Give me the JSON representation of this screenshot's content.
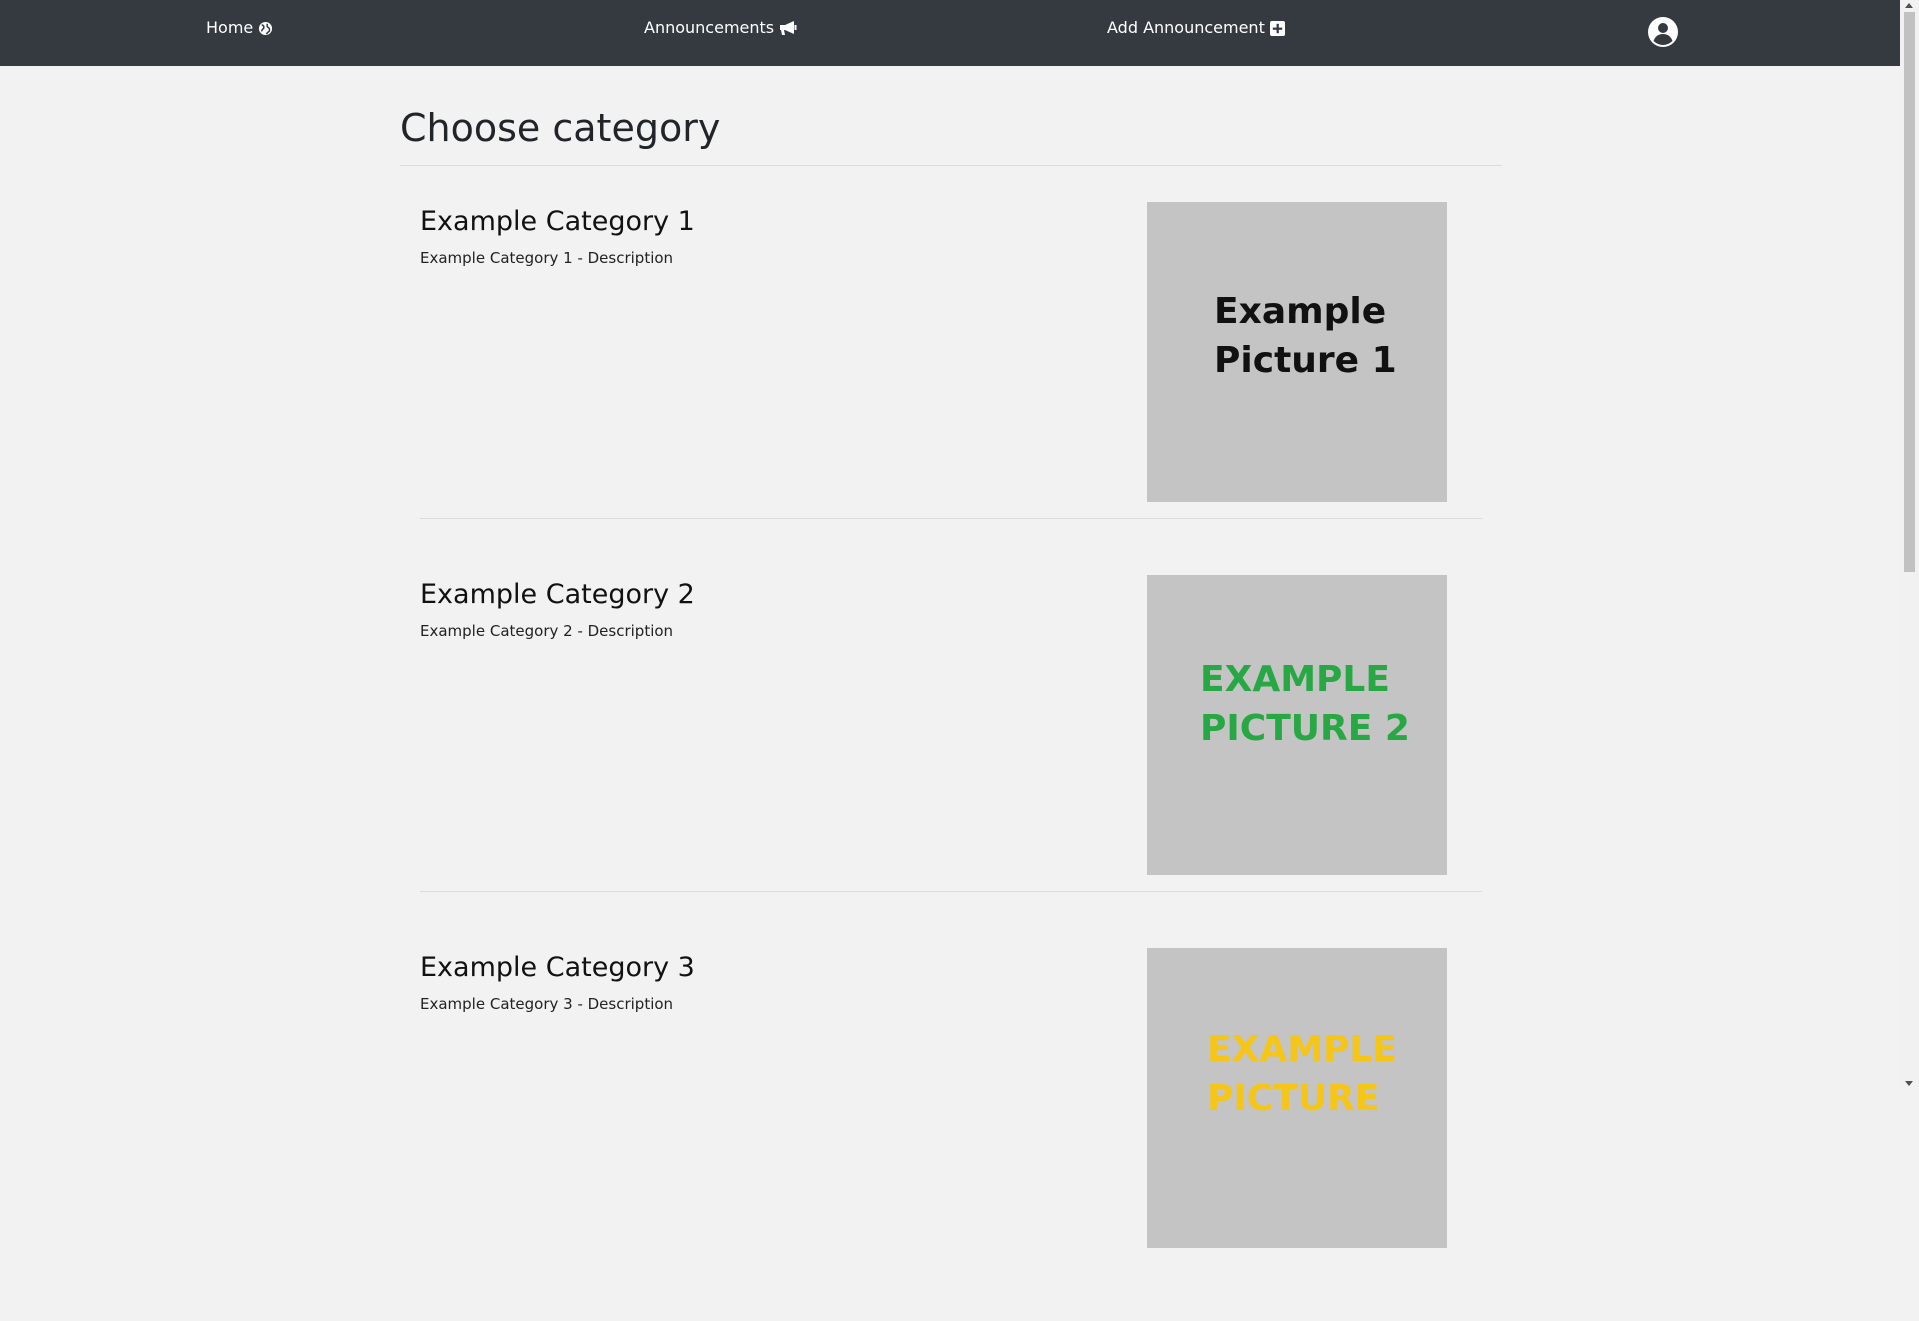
{
  "nav": {
    "home_label": "Home",
    "announcements_label": "Announcements",
    "add_announcement_label": "Add Announcement"
  },
  "page": {
    "title": "Choose category"
  },
  "categories": [
    {
      "name": "Example Category 1",
      "description": "Example Category 1 - Description",
      "picture_line1": "Example",
      "picture_line2": "Picture 1",
      "picture_color": "#111111"
    },
    {
      "name": "Example Category 2",
      "description": "Example Category 2 - Description",
      "picture_line1": "EXAMPLE",
      "picture_line2": "PICTURE 2",
      "picture_color": "#27a844"
    },
    {
      "name": "Example Category 3",
      "description": "Example Category 3 - Description",
      "picture_line1": "EXAMPLE",
      "picture_line2": "PICTURE",
      "picture_color": "#f5c518"
    }
  ],
  "colors": {
    "navbar": "#343a40",
    "background": "#f2f2f2",
    "picture_bg": "#c4c4c4"
  },
  "icons": {
    "home": "globe-icon",
    "announcements": "megaphone-icon",
    "add": "plus-square-icon",
    "user": "user-circle-icon"
  }
}
